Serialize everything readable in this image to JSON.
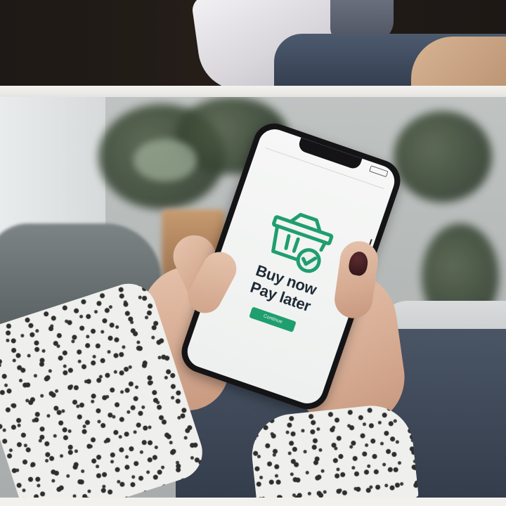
{
  "phone_screen": {
    "title_line_1": "Buy now",
    "title_line_2": "Pay later",
    "button_label": "Continue",
    "icon": "shopping-basket-check-icon"
  },
  "colors": {
    "accent_green": "#1f9e6e",
    "title_text": "#1f2b36"
  }
}
